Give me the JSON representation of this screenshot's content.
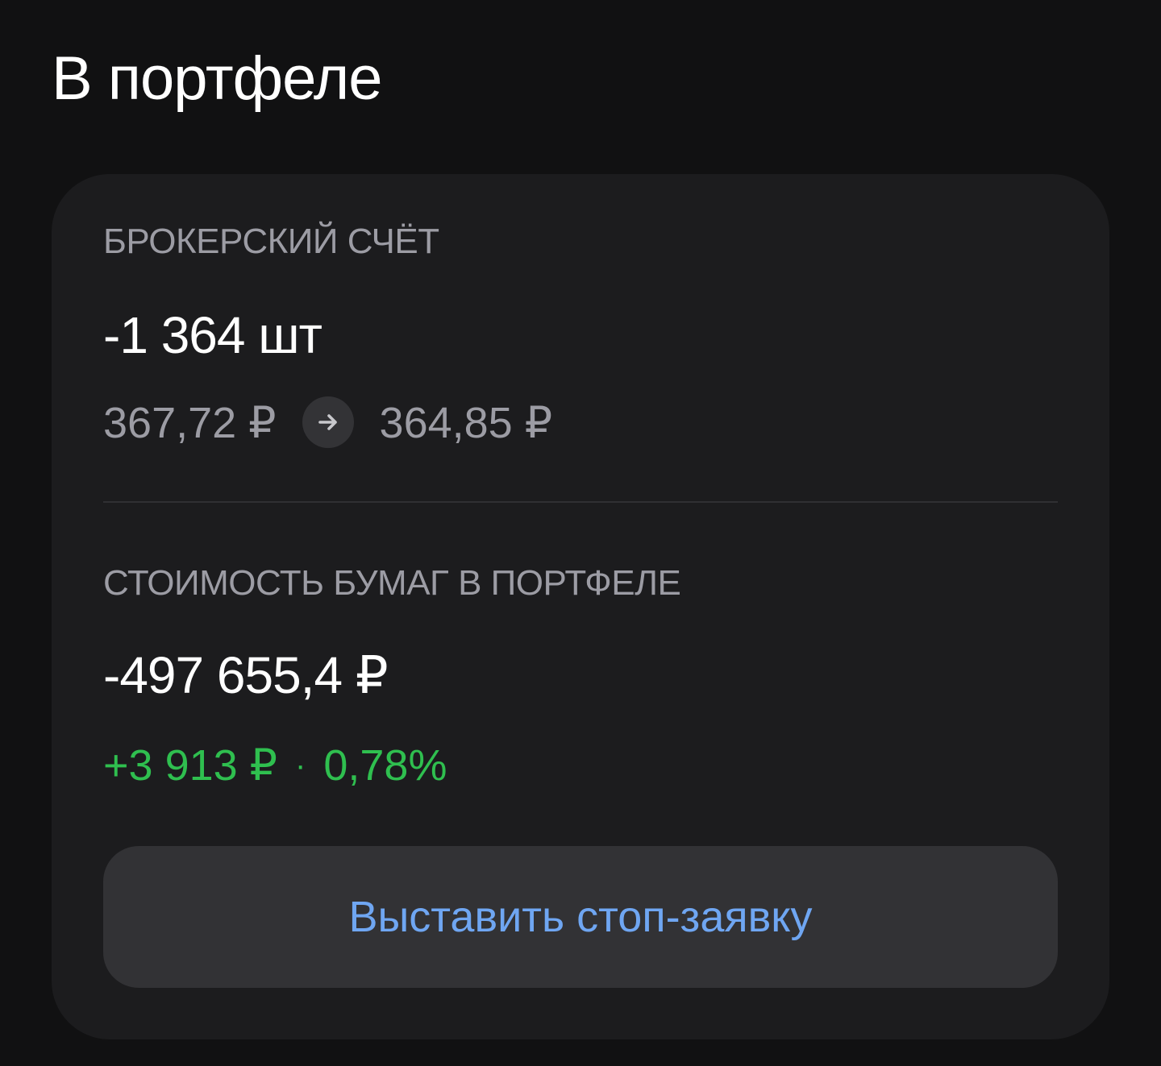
{
  "header": {
    "title": "В портфеле"
  },
  "broker_account": {
    "label": "БРОКЕРСКИЙ СЧЁТ",
    "quantity": "-1 364 шт",
    "price_from": "367,72 ₽",
    "price_to": "364,85 ₽",
    "arrow_icon": "arrow-right-icon"
  },
  "portfolio_value": {
    "label": "СТОИМОСТЬ БУМАГ В ПОРТФЕЛЕ",
    "value": "-497 655,4 ₽",
    "change_amount": "+3 913 ₽",
    "separator": "·",
    "change_percent": "0,78%"
  },
  "actions": {
    "stop_order_label": "Выставить стоп-заявку"
  },
  "colors": {
    "background": "#111112",
    "card": "#1c1c1e",
    "muted_text": "#9c9ca4",
    "positive": "#2fbf4f",
    "link": "#6fa6f2",
    "button_bg": "#323235"
  }
}
